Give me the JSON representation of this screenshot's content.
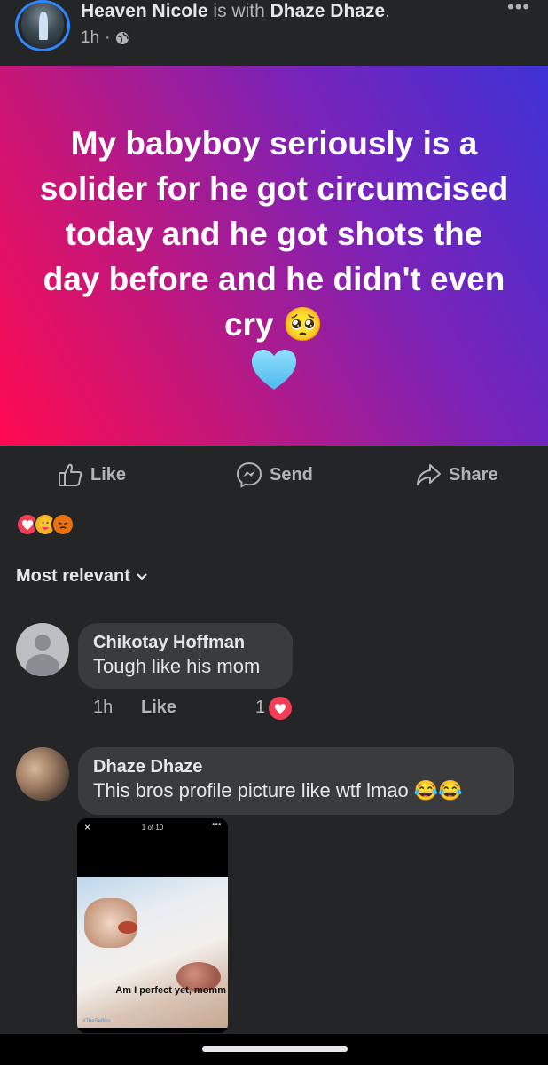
{
  "post": {
    "author": "Heaven Nicole",
    "with_text": " is with ",
    "tagged": "Dhaze Dhaze",
    "period": ".",
    "time": "1h",
    "dot": "·",
    "status_text": "My babyboy seriously is a solider for he got circumcised today and he got shots the day before and he didn't even cry 🥺",
    "status_colors": [
      "#ff0a50",
      "#7a23b8",
      "#3f32d6"
    ]
  },
  "actions": {
    "like_label": "Like",
    "send_label": "Send",
    "share_label": "Share"
  },
  "reactions": [
    "love",
    "care",
    "angry"
  ],
  "sort": {
    "label": "Most relevant"
  },
  "comments": [
    {
      "author": "Chikotay Hoffman",
      "text": "Tough like his mom",
      "time": "1h",
      "like_label": "Like",
      "reaction_count": "1"
    },
    {
      "author": "Dhaze Dhaze",
      "text": "This bros profile picture like wtf lmao 😂😂",
      "attachment": {
        "close": "×",
        "counter": "1 of 10",
        "caption": "Am I perfect yet, momm",
        "watermark": "#TheSelfies"
      }
    }
  ],
  "colors": {
    "background": "#242526",
    "bubble": "#3a3b3c",
    "accent": "#2d88ff",
    "love": "#f33e58"
  }
}
